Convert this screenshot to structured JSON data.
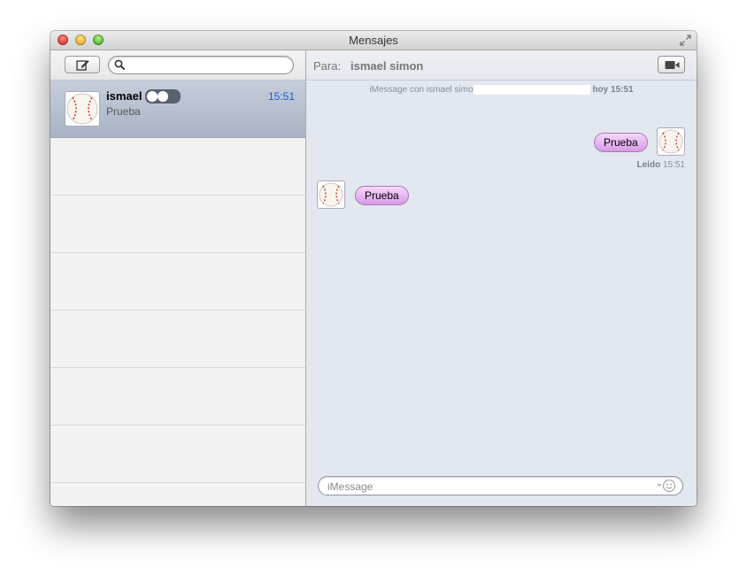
{
  "window": {
    "title": "Mensajes"
  },
  "sidebar": {
    "search": {
      "placeholder": "",
      "value": ""
    },
    "conversations": [
      {
        "name": "ismael",
        "time": "15:51",
        "preview": "Prueba",
        "selected": true
      }
    ]
  },
  "chat": {
    "to_label": "Para:",
    "to_name": "ismael simon",
    "info": {
      "prefix": "iMessage con ismael simo",
      "day": "hoy 15:51"
    },
    "messages": [
      {
        "direction": "out",
        "text": "Prueba"
      },
      {
        "direction": "in",
        "text": "Prueba"
      }
    ],
    "read_receipt": {
      "label": "Leído",
      "time": "15:51"
    },
    "compose": {
      "placeholder": "iMessage",
      "value": ""
    }
  },
  "colors": {
    "bubble": "#e0aef0",
    "time": "#1a5bd6",
    "selected_row": "#b5bece",
    "chat_bg": "#e3e7ef"
  },
  "icons": [
    "compose-icon",
    "search-icon",
    "video-camera-icon",
    "emoji-icon",
    "fullscreen-icon",
    "baseball-avatar-icon"
  ]
}
